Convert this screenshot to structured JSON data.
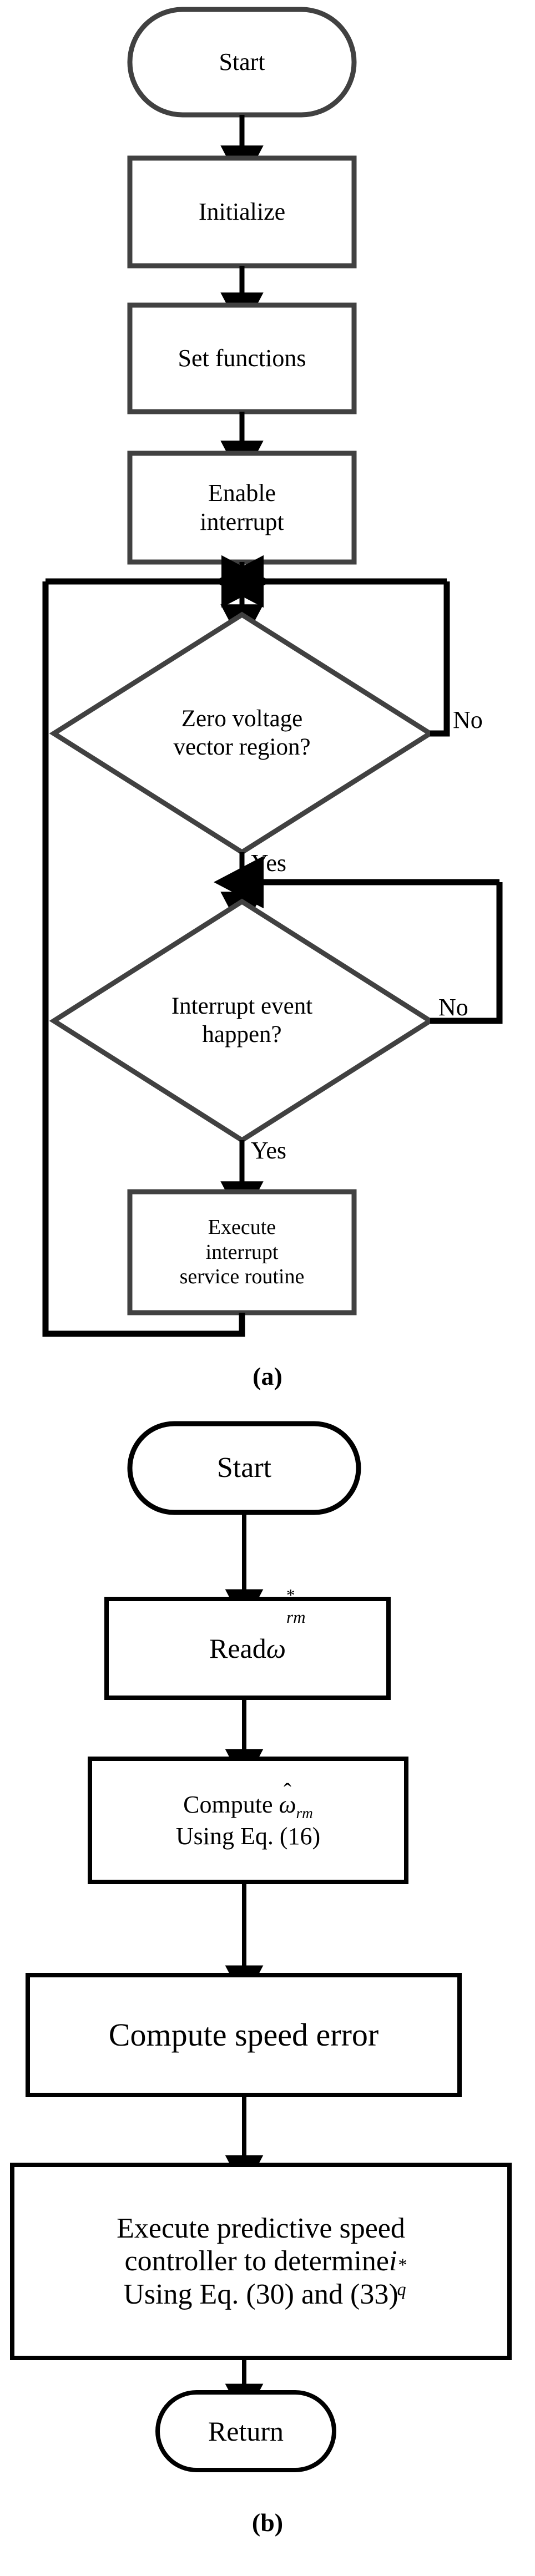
{
  "figure": {
    "panel_a": {
      "caption": "(a)",
      "nodes": {
        "start": {
          "label": "Start",
          "shape": "terminator"
        },
        "initialize": {
          "label": "Initialize",
          "shape": "process"
        },
        "set_functions": {
          "label": "Set functions",
          "shape": "process"
        },
        "enable_interrupt": {
          "label": "Enable\ninterrupt",
          "shape": "process"
        },
        "decision_zero_voltage": {
          "label": "Zero voltage\nvector region?",
          "shape": "decision"
        },
        "decision_interrupt_event": {
          "label": "Interrupt event\nhappen?",
          "shape": "decision"
        },
        "execute_isr": {
          "label": "Execute\ninterrupt\nservice routine",
          "shape": "process"
        }
      },
      "edge_labels": {
        "zero_voltage_no": "No",
        "zero_voltage_yes": "Yes",
        "interrupt_event_no": "No",
        "interrupt_event_yes": "Yes"
      }
    },
    "panel_b": {
      "caption": "(b)",
      "nodes": {
        "start": {
          "label": "Start",
          "shape": "terminator"
        },
        "read_speed_ref": {
          "shape": "process",
          "text_prefix": "Read ",
          "symbol": "ω",
          "sup": "*",
          "sub": "rm",
          "plain": "Read ω*rm"
        },
        "compute_speed_est": {
          "shape": "process",
          "line1_prefix": "Compute ",
          "symbol": "ω",
          "hat": "ˆ",
          "sub": "rm",
          "line2": "Using Eq. (16)",
          "plain": "Compute ω̂rm Using Eq. (16)"
        },
        "compute_speed_error": {
          "label": "Compute speed error",
          "shape": "process"
        },
        "execute_predictive_controller": {
          "shape": "process",
          "line1": "Execute predictive speed",
          "line2_prefix": "controller to determine",
          "symbol": "i",
          "sup": "*",
          "sub": "q",
          "line3": "Using Eq. (30) and (33)",
          "plain": "Execute predictive speed controller to determine i*q Using Eq. (30) and (33)"
        },
        "return": {
          "label": "Return",
          "shape": "terminator"
        }
      }
    }
  },
  "colors": {
    "shape_stroke_a": "#414141",
    "flow_stroke": "#000000",
    "background": "#ffffff",
    "text": "#000000"
  }
}
